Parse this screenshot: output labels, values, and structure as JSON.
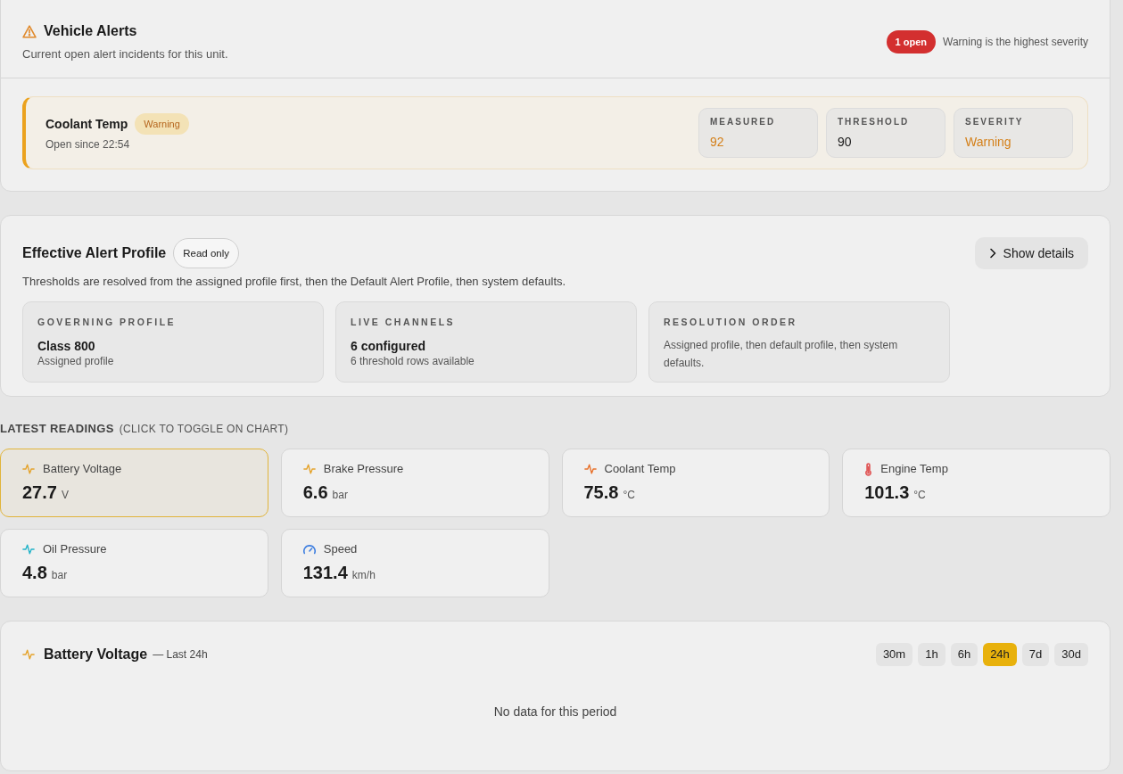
{
  "alerts_panel": {
    "title": "Vehicle Alerts",
    "subtitle": "Current open alert incidents for this unit.",
    "open_count": "1 open",
    "summary": "Warning is the highest severity",
    "incidents": [
      {
        "kind": "warning",
        "name": "Coolant Temp",
        "severity": "Warning",
        "opened": "Open since 22:54",
        "metrics": [
          {
            "label": "MEASURED",
            "value": "92",
            "highlighted": true
          },
          {
            "label": "THRESHOLD",
            "value": "90",
            "highlighted": false
          },
          {
            "label": "SEVERITY",
            "value": "Warning",
            "highlighted": true
          }
        ]
      }
    ]
  },
  "profile_panel": {
    "title": "Effective Alert Profile",
    "badge": "Read only",
    "button": "Show details",
    "expanded": false,
    "description": "Thresholds are resolved from the assigned profile first, then the Default Alert Profile, then system defaults.",
    "facts": [
      {
        "kind": "stat",
        "label": "GOVERNING PROFILE",
        "value": "Class 800",
        "detail": "Assigned profile"
      },
      {
        "kind": "stat",
        "label": "LIVE CHANNELS",
        "value": "6 configured",
        "detail": "6 threshold rows available"
      },
      {
        "kind": "note",
        "label": "RESOLUTION ORDER",
        "text": "Assigned profile, then default profile, then system defaults."
      }
    ]
  },
  "readings": {
    "title": "LATEST READINGS",
    "hint": "(CLICK TO TOGGLE ON CHART)",
    "items": [
      {
        "kind": "signal",
        "label": "Battery Voltage",
        "value": "27.7",
        "unit": "V",
        "color": "#e5a32b",
        "selected": true
      },
      {
        "kind": "signal",
        "label": "Brake Pressure",
        "value": "6.6",
        "unit": "bar",
        "color": "#e5a32b",
        "selected": false
      },
      {
        "kind": "signal",
        "label": "Coolant Temp",
        "value": "75.8",
        "unit": "°C",
        "color": "#e8702a",
        "selected": false
      },
      {
        "kind": "temperature",
        "label": "Engine Temp",
        "value": "101.3",
        "unit": "°C",
        "color": "#e05555",
        "selected": false
      },
      {
        "kind": "signal",
        "label": "Oil Pressure",
        "value": "4.8",
        "unit": "bar",
        "color": "#22b3c9",
        "selected": false
      },
      {
        "kind": "speed",
        "label": "Speed",
        "value": "131.4",
        "unit": "km/h",
        "color": "#3f7fe0",
        "selected": false
      }
    ]
  },
  "chart_panel": {
    "title": "Battery Voltage",
    "period": "— Last 24h",
    "ranges": [
      {
        "label": "30m",
        "selected": false
      },
      {
        "label": "1h",
        "selected": false
      },
      {
        "label": "6h",
        "selected": false
      },
      {
        "label": "24h",
        "selected": true
      },
      {
        "label": "7d",
        "selected": false
      },
      {
        "label": "30d",
        "selected": false
      }
    ],
    "empty_message": "No data for this period"
  }
}
